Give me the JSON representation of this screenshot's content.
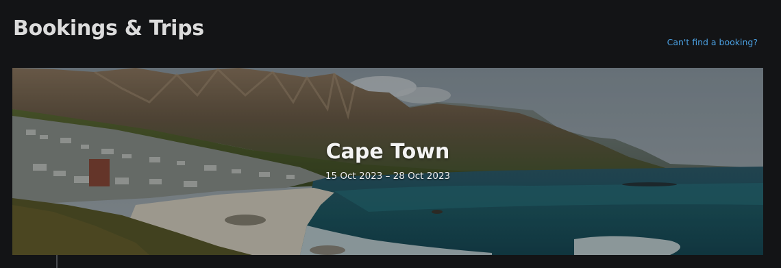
{
  "header": {
    "title": "Bookings & Trips",
    "help_link": "Can't find a booking?"
  },
  "trip": {
    "destination": "Cape Town",
    "dates": "15 Oct 2023 – 28 Oct 2023",
    "image_subject": "coastal-mountain-landscape"
  },
  "colors": {
    "background": "#131416",
    "title": "#dcdcdc",
    "link": "#4a9fe0"
  }
}
